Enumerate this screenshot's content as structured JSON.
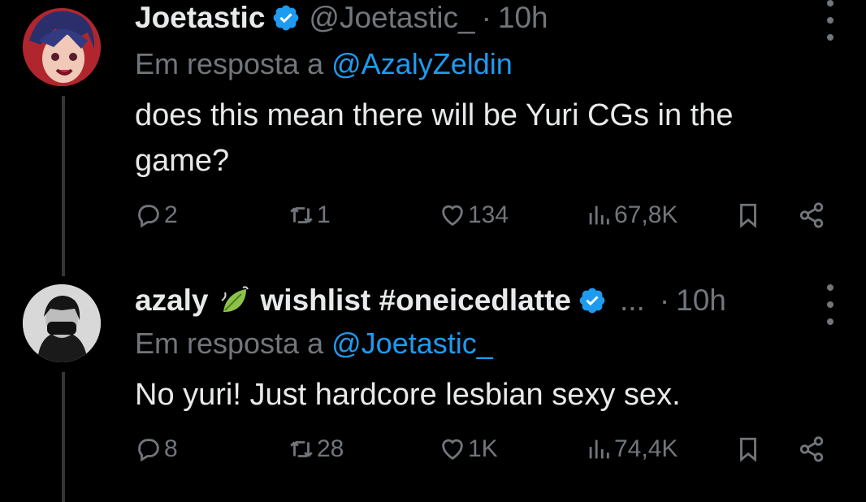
{
  "tweets": [
    {
      "display_name": "Joetastic",
      "handle": "@Joetastic_",
      "separator": "·",
      "time": "10h",
      "replying_prefix": "Em resposta a",
      "replying_to": "@AzalyZeldin",
      "text": "does this mean there will be Yuri CGs in the game?",
      "stats": {
        "replies": "2",
        "reposts": "1",
        "likes": "134",
        "views": "67,8K"
      }
    },
    {
      "display_name_part1": "azaly",
      "display_name_part2": "wishlist #oneicedlatte",
      "ellipsis": "...",
      "separator": "·",
      "time": "10h",
      "replying_prefix": "Em resposta a",
      "replying_to": "@Joetastic_",
      "text": "No yuri! Just hardcore lesbian sexy sex.",
      "stats": {
        "replies": "8",
        "reposts": "28",
        "likes": "1K",
        "views": "74,4K"
      }
    }
  ],
  "colors": {
    "accent": "#1d9bf0",
    "muted": "#71767b",
    "text": "#e7e9ea",
    "leaf": "#8bc34a"
  },
  "icons": [
    "verified-badge-icon",
    "more-icon",
    "reply-icon",
    "repost-icon",
    "like-icon",
    "views-icon",
    "bookmark-icon",
    "share-icon",
    "leaf-emoji-icon"
  ]
}
